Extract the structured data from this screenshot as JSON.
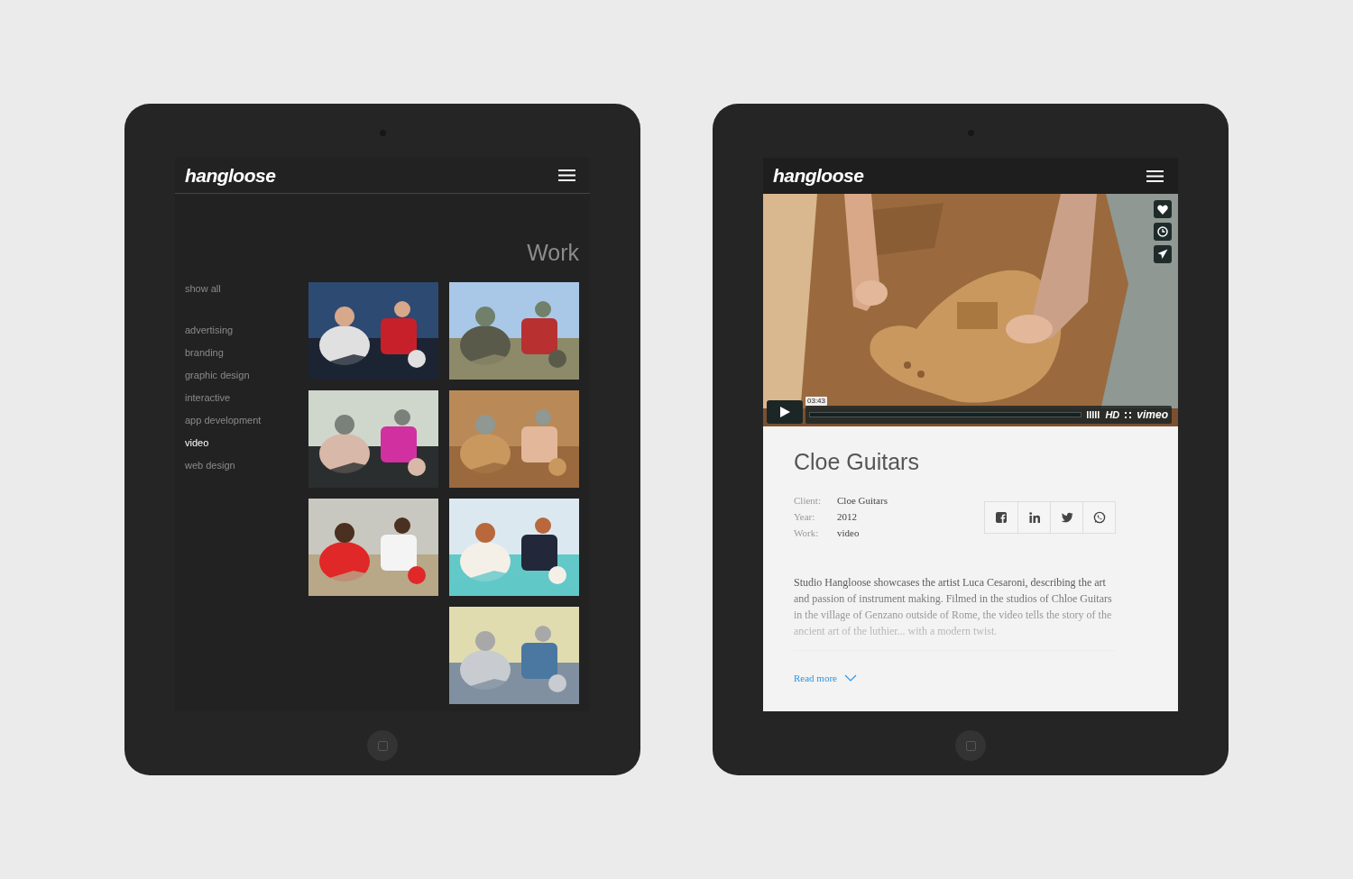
{
  "work_page": {
    "logo": "hangloose",
    "heading": "Work",
    "categories": [
      {
        "label": "show all",
        "selected": false,
        "kind": "all"
      },
      {
        "label": "advertising",
        "selected": false,
        "kind": "item"
      },
      {
        "label": "branding",
        "selected": false,
        "kind": "item"
      },
      {
        "label": "graphic design",
        "selected": false,
        "kind": "item"
      },
      {
        "label": "interactive",
        "selected": false,
        "kind": "item"
      },
      {
        "label": "app development",
        "selected": false,
        "kind": "item"
      },
      {
        "label": "video",
        "selected": true,
        "kind": "item"
      },
      {
        "label": "web design",
        "selected": false,
        "kind": "item"
      }
    ],
    "thumbnails": [
      {
        "kind": "picture"
      },
      {
        "kind": "picture"
      },
      {
        "kind": "picture"
      },
      {
        "kind": "picture"
      },
      {
        "kind": "picture"
      },
      {
        "kind": "picture"
      },
      {
        "kind": "empty"
      },
      {
        "kind": "picture"
      }
    ]
  },
  "detail_page": {
    "logo": "hangloose",
    "video": {
      "time": "03:43",
      "quality": "HD",
      "brand": "vimeo"
    },
    "title": "Cloe Guitars",
    "meta": [
      {
        "label": "Client:",
        "value": "Cloe Guitars"
      },
      {
        "label": "Year:",
        "value": "2012"
      },
      {
        "label": "Work:",
        "value": "video"
      }
    ],
    "share_buttons": [
      {
        "kind": "facebook"
      },
      {
        "kind": "linkedin"
      },
      {
        "kind": "twitter"
      },
      {
        "kind": "whatsapp"
      }
    ],
    "description": "Studio Hangloose showcases the artist Luca Cesaroni, describing the art and passion of instrument making. Filmed in the studios of Chloe Guitars in the village of Genzano outside of Rome, the video tells the story of the ancient art of the luthier... with a modern twist.",
    "read_more": "Read more"
  }
}
